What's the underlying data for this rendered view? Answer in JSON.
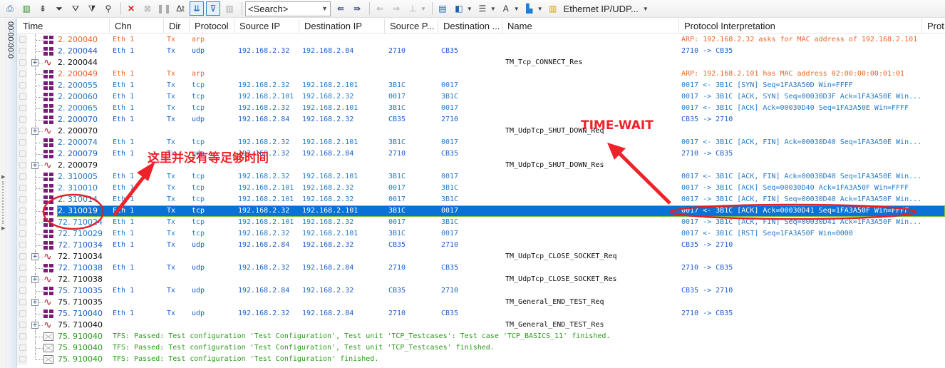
{
  "toolbar": {
    "search_placeholder": "<Search>",
    "protocol_selector": "Ethernet IP/UDP...",
    "icons": [
      "export-icon",
      "statistics-icon",
      "expand-icon",
      "filter-icon",
      "filter-glasses-icon",
      "filter-sort-icon",
      "find-icon",
      "delete-icon",
      "clear-filter-icon",
      "pause-icon",
      "delta-time-icon",
      "autoscroll-icon",
      "filter-view-icon",
      "column-icon",
      "find-previous-icon",
      "find-next-icon",
      "back-icon",
      "forward-icon",
      "marker-icon",
      "window-layout-icon",
      "window-color-icon",
      "line-style-icon",
      "font-size-icon",
      "color-scheme-icon",
      "protocol-view-icon"
    ]
  },
  "timeline": {
    "label": "0:00:00:00"
  },
  "columns": [
    "Time",
    "Chn",
    "Dir",
    "Protocol",
    "Source IP",
    "Destination IP",
    "Source P...",
    "Destination ...",
    "Name",
    "Protocol Interpretation",
    "Prot"
  ],
  "rows": [
    {
      "type": "frame",
      "color": "orange",
      "time": "2. 200040",
      "chn": "Eth 1",
      "dir": "Tx",
      "proto": "arp",
      "src": "",
      "dst": "",
      "sp": "",
      "dp": "",
      "name": "",
      "interp": "ARP: 192.168.2.32 asks for MAC address of 192.168.2.101"
    },
    {
      "type": "frame",
      "color": "blue",
      "time": "2. 200044",
      "chn": "Eth 1",
      "dir": "Tx",
      "proto": "udp",
      "src": "192.168.2.32",
      "dst": "192.168.2.84",
      "sp": "2710",
      "dp": "CB35",
      "name": "",
      "interp": "2710 -> CB35"
    },
    {
      "type": "signal",
      "time": "2. 200044",
      "name": "TM_Tcp_CONNECT_Res"
    },
    {
      "type": "frame",
      "color": "orange",
      "time": "2. 200049",
      "chn": "Eth 1",
      "dir": "Tx",
      "proto": "arp",
      "src": "",
      "dst": "",
      "sp": "",
      "dp": "",
      "name": "",
      "interp": "ARP: 192.168.2.101 has MAC address 02:00:00:00:01:01"
    },
    {
      "type": "frame",
      "color": "blue2",
      "time": "2. 200055",
      "chn": "Eth 1",
      "dir": "Tx",
      "proto": "tcp",
      "src": "192.168.2.32",
      "dst": "192.168.2.101",
      "sp": "3B1C",
      "dp": "0017",
      "name": "",
      "interp": "0017 <- 3B1C [SYN] Seq=1FA3A50D Win=FFFF"
    },
    {
      "type": "frame",
      "color": "blue2",
      "time": "2. 200060",
      "chn": "Eth 1",
      "dir": "Tx",
      "proto": "tcp",
      "src": "192.168.2.101",
      "dst": "192.168.2.32",
      "sp": "0017",
      "dp": "3B1C",
      "name": "",
      "interp": "0017 -> 3B1C [ACK, SYN] Seq=00030D3F Ack=1FA3A50E Win..."
    },
    {
      "type": "frame",
      "color": "blue2",
      "time": "2. 200065",
      "chn": "Eth 1",
      "dir": "Tx",
      "proto": "tcp",
      "src": "192.168.2.32",
      "dst": "192.168.2.101",
      "sp": "3B1C",
      "dp": "0017",
      "name": "",
      "interp": "0017 <- 3B1C [ACK] Ack=00030D40 Seq=1FA3A50E Win=FFFF"
    },
    {
      "type": "frame",
      "color": "blue",
      "time": "2. 200070",
      "chn": "Eth 1",
      "dir": "Tx",
      "proto": "udp",
      "src": "192.168.2.84",
      "dst": "192.168.2.32",
      "sp": "CB35",
      "dp": "2710",
      "name": "",
      "interp": "CB35 -> 2710"
    },
    {
      "type": "signal",
      "time": "2. 200070",
      "name": "TM_UdpTcp_SHUT_DOWN_Req"
    },
    {
      "type": "frame",
      "color": "blue2",
      "time": "2. 200074",
      "chn": "Eth 1",
      "dir": "Tx",
      "proto": "tcp",
      "src": "192.168.2.32",
      "dst": "192.168.2.101",
      "sp": "3B1C",
      "dp": "0017",
      "name": "",
      "interp": "0017 <- 3B1C [ACK, FIN] Ack=00030D40 Seq=1FA3A50E Win..."
    },
    {
      "type": "frame",
      "color": "blue",
      "time": "2. 200079",
      "chn": "Eth 1",
      "dir": "Tx",
      "proto": "udp",
      "src": "192.168.2.32",
      "dst": "192.168.2.84",
      "sp": "2710",
      "dp": "CB35",
      "name": "",
      "interp": "2710 -> CB35"
    },
    {
      "type": "signal",
      "time": "2. 200079",
      "name": "TM_UdpTcp_SHUT_DOWN_Res"
    },
    {
      "type": "frame",
      "color": "blue2",
      "time": "2. 310005",
      "chn": "Eth 1",
      "dir": "Tx",
      "proto": "tcp",
      "src": "192.168.2.32",
      "dst": "192.168.2.101",
      "sp": "3B1C",
      "dp": "0017",
      "name": "",
      "interp": "0017 <- 3B1C [ACK, FIN] Ack=00030D40 Seq=1FA3A50E Win..."
    },
    {
      "type": "frame",
      "color": "blue2",
      "time": "2. 310010",
      "chn": "Eth 1",
      "dir": "Tx",
      "proto": "tcp",
      "src": "192.168.2.101",
      "dst": "192.168.2.32",
      "sp": "0017",
      "dp": "3B1C",
      "name": "",
      "interp": "0017 -> 3B1C [ACK] Seq=00030D40 Ack=1FA3A50F Win=FFFF"
    },
    {
      "type": "frame",
      "color": "blue2",
      "time": "2. 310014",
      "chn": "Eth 1",
      "dir": "Tx",
      "proto": "tcp",
      "src": "192.168.2.101",
      "dst": "192.168.2.32",
      "sp": "0017",
      "dp": "3B1C",
      "name": "",
      "interp": "0017 -> 3B1C [ACK, FIN] Seq=00030D40 Ack=1FA3A50F Win..."
    },
    {
      "type": "frame",
      "color": "blue2",
      "selected": true,
      "time": "2. 310019",
      "chn": "Eth 1",
      "dir": "Tx",
      "proto": "tcp",
      "src": "192.168.2.32",
      "dst": "192.168.2.101",
      "sp": "3B1C",
      "dp": "0017",
      "name": "",
      "interp": "0017 <- 3B1C [ACK] Ack=00030D41 Seq=1FA3A50F Win=FFFF"
    },
    {
      "type": "frame",
      "color": "blue2",
      "time": "72. 710024",
      "chn": "Eth 1",
      "dir": "Tx",
      "proto": "tcp",
      "src": "192.168.2.101",
      "dst": "192.168.2.32",
      "sp": "0017",
      "dp": "3B1C",
      "name": "",
      "interp": "0017 -> 3B1C [ACK, FIN] Seq=00030D41 Ack=1FA3A50F Win..."
    },
    {
      "type": "frame",
      "color": "blue2",
      "time": "72. 710029",
      "chn": "Eth 1",
      "dir": "Tx",
      "proto": "tcp",
      "src": "192.168.2.32",
      "dst": "192.168.2.101",
      "sp": "3B1C",
      "dp": "0017",
      "name": "",
      "interp": "0017 <- 3B1C [RST] Seq=1FA3A50F Win=0000"
    },
    {
      "type": "frame",
      "color": "blue",
      "time": "72. 710034",
      "chn": "Eth 1",
      "dir": "Tx",
      "proto": "udp",
      "src": "192.168.2.84",
      "dst": "192.168.2.32",
      "sp": "CB35",
      "dp": "2710",
      "name": "",
      "interp": "CB35 -> 2710"
    },
    {
      "type": "signal",
      "time": "72. 710034",
      "name": "TM_UdpTcp_CLOSE_SOCKET_Req"
    },
    {
      "type": "frame",
      "color": "blue",
      "time": "72. 710038",
      "chn": "Eth 1",
      "dir": "Tx",
      "proto": "udp",
      "src": "192.168.2.32",
      "dst": "192.168.2.84",
      "sp": "2710",
      "dp": "CB35",
      "name": "",
      "interp": "2710 -> CB35"
    },
    {
      "type": "signal",
      "time": "72. 710038",
      "name": "TM_UdpTcp_CLOSE_SOCKET_Res"
    },
    {
      "type": "frame",
      "color": "blue",
      "time": "75. 710035",
      "chn": "Eth 1",
      "dir": "Tx",
      "proto": "udp",
      "src": "192.168.2.84",
      "dst": "192.168.2.32",
      "sp": "CB35",
      "dp": "2710",
      "name": "",
      "interp": "CB35 -> 2710"
    },
    {
      "type": "signal",
      "time": "75. 710035",
      "name": "TM_General_END_TEST_Req"
    },
    {
      "type": "frame",
      "color": "blue",
      "time": "75. 710040",
      "chn": "Eth 1",
      "dir": "Tx",
      "proto": "udp",
      "src": "192.168.2.32",
      "dst": "192.168.2.84",
      "sp": "2710",
      "dp": "CB35",
      "name": "",
      "interp": "2710 -> CB35"
    },
    {
      "type": "signal",
      "time": "75. 710040",
      "name": "TM_General_END_TEST_Res"
    },
    {
      "type": "msg",
      "time": "75. 910040",
      "text": "TFS: Passed: Test configuration 'Test Configuration', Test unit 'TCP_Testcases': Test case 'TCP_BASICS_11' finished."
    },
    {
      "type": "msg",
      "time": "75. 910040",
      "text": "TFS: Passed: Test configuration 'Test Configuration', Test unit 'TCP_Testcases' finished."
    },
    {
      "type": "msg",
      "time": "75. 910040",
      "text": "TFS: Passed: Test configuration 'Test Configuration' finished."
    }
  ],
  "annotations": {
    "left_note": "这里并没有等足够时间",
    "right_note": "TIME-WAIT",
    "color": "#ee2228"
  },
  "colors": {
    "selection": "#0a72d6",
    "arp": "#e8652a",
    "udp": "#1a5fc8",
    "tcp": "#2679c4",
    "test_message": "#2a9a1a",
    "frame_icon": "#7b1c7a"
  }
}
